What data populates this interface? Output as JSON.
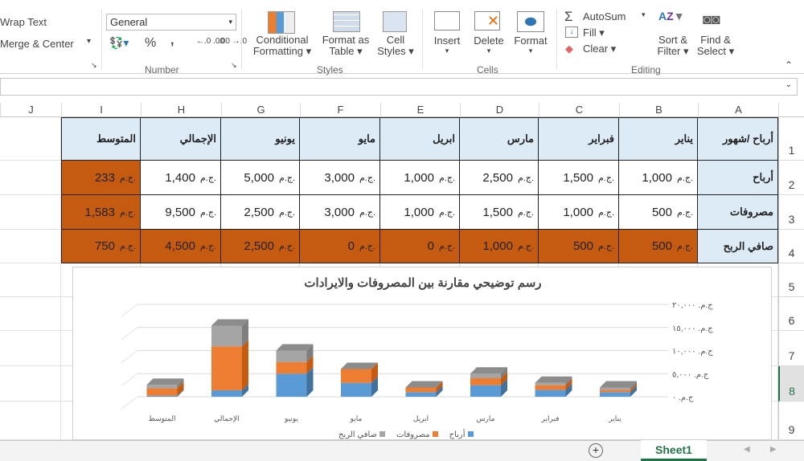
{
  "ribbon": {
    "wrap_text": "Wrap Text",
    "merge_center": "Merge & Center",
    "number_format": "General",
    "percent": "%",
    "comma": ",",
    "inc_dec": "←.0 .00",
    "dec_dec": ".00 →.0",
    "conditional_formatting": [
      "Conditional",
      "Formatting ▾"
    ],
    "format_as_table": [
      "Format as",
      "Table ▾"
    ],
    "cell_styles": [
      "Cell",
      "Styles ▾"
    ],
    "insert": "Insert",
    "delete": "Delete",
    "format": "Format",
    "autosum": "AutoSum",
    "fill": "Fill ▾",
    "clear": "Clear ▾",
    "sort_filter": [
      "Sort &",
      "Filter ▾"
    ],
    "find_select": [
      "Find &",
      "Select ▾"
    ],
    "groups": {
      "number": "Number",
      "styles": "Styles",
      "cells": "Cells",
      "editing": "Editing"
    }
  },
  "columns": [
    "A",
    "B",
    "C",
    "D",
    "E",
    "F",
    "G",
    "H",
    "I",
    "J"
  ],
  "rows": [
    "1",
    "2",
    "3",
    "4",
    "5",
    "6",
    "7",
    "8",
    "9"
  ],
  "currency": "ج.م.",
  "table": {
    "header": [
      "أرباح /شهور",
      "يناير",
      "فبراير",
      "مارس",
      "ابريل",
      "مايو",
      "يونيو",
      "الإجمالي",
      "المتوسط"
    ],
    "body": [
      {
        "label": "أرباح",
        "values": [
          "1,000",
          "1,500",
          "2,500",
          "1,000",
          "3,000",
          "5,000",
          "1,400",
          "233"
        ]
      },
      {
        "label": "مصروفات",
        "values": [
          "500",
          "1,000",
          "1,500",
          "1,000",
          "3,000",
          "2,500",
          "9,500",
          "1,583"
        ]
      },
      {
        "label": "صافي الربح",
        "values": [
          "500",
          "500",
          "1,000",
          "0",
          "0",
          "2,500",
          "4,500",
          "750"
        ]
      }
    ]
  },
  "colors": {
    "profit": "#5b9bd5",
    "expenses": "#ed7d31",
    "net": "#a5a5a5",
    "highlight": "#c55a11",
    "header": "#ddebf7"
  },
  "chart_data": {
    "type": "bar",
    "stacked": true,
    "3d": true,
    "title": "رسم توضيحي مقارنة بين المصروفات والايرادات",
    "categories": [
      "يناير",
      "فبراير",
      "مارس",
      "ابريل",
      "مايو",
      "يونيو",
      "الإجمالي",
      "المتوسط"
    ],
    "series": [
      {
        "name": "أرباح",
        "values": [
          1000,
          1500,
          2500,
          1000,
          3000,
          5000,
          1400,
          233
        ]
      },
      {
        "name": "مصروفات",
        "values": [
          500,
          1000,
          1500,
          1000,
          3000,
          2500,
          9500,
          1583
        ]
      },
      {
        "name": "صافي الربح",
        "values": [
          500,
          500,
          1000,
          0,
          0,
          2500,
          4500,
          750
        ]
      }
    ],
    "ylim": [
      0,
      20000
    ],
    "yticks": [
      "ج.م. ٠",
      "ج.م. ٥,٠٠٠",
      "ج.م. ١٠,٠٠٠",
      "ج.م. ١٥,٠٠٠",
      "ج.م. ٢٠,٠٠٠"
    ],
    "legend": "bottom"
  },
  "sheet_tab": "Sheet1"
}
